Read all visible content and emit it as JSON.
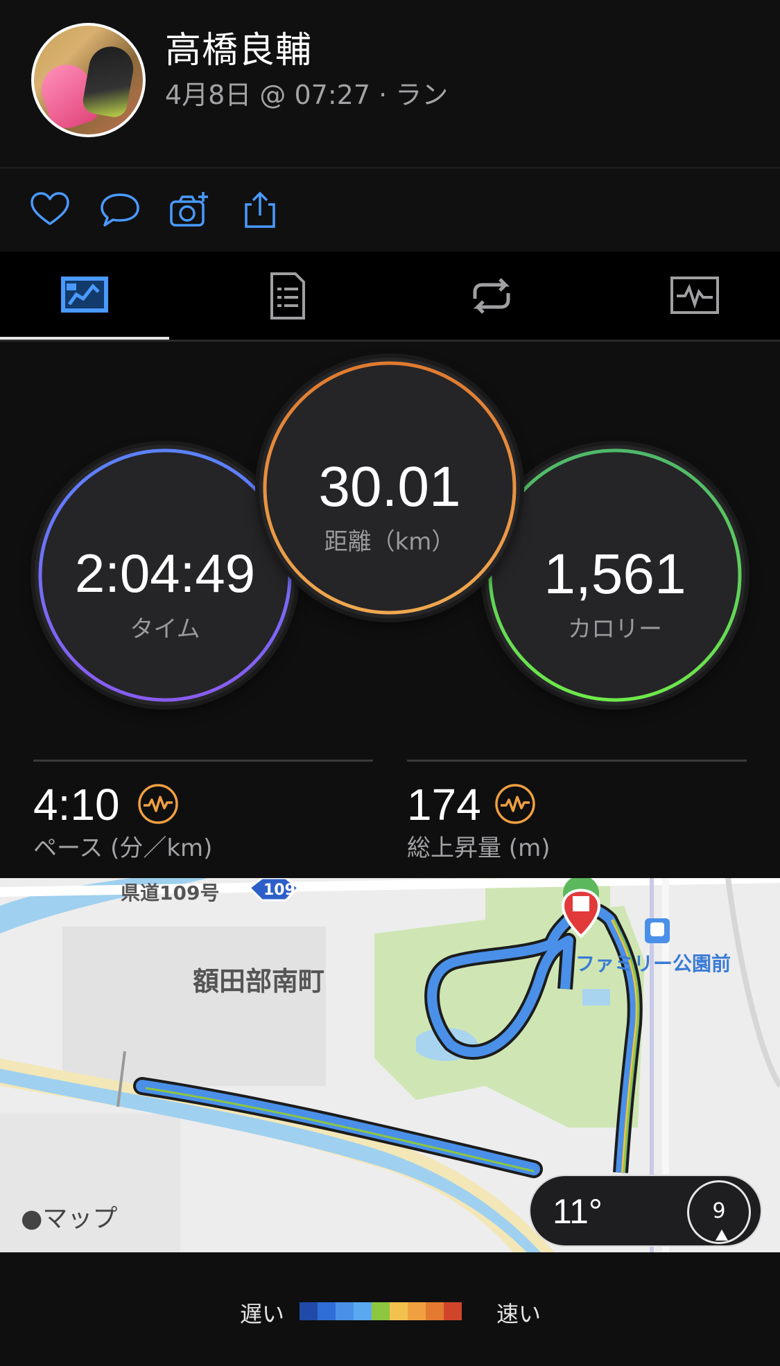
{
  "header": {
    "user_name": "高橋良輔",
    "meta": "4月8日 @ 07:27 · ラン"
  },
  "actions": [
    {
      "name": "like-heart-icon"
    },
    {
      "name": "comment-bubble-icon"
    },
    {
      "name": "add-photo-camera-icon"
    },
    {
      "name": "share-icon"
    }
  ],
  "tabs": [
    {
      "name": "tab-overview",
      "icon": "overview-icon",
      "active": true
    },
    {
      "name": "tab-stats",
      "icon": "document-list-icon",
      "active": false
    },
    {
      "name": "tab-laps",
      "icon": "repeat-icon",
      "active": false
    },
    {
      "name": "tab-charts",
      "icon": "activity-chart-icon",
      "active": false
    }
  ],
  "rings": {
    "time": {
      "value": "2:04:49",
      "label": "タイム"
    },
    "distance": {
      "value": "30.01",
      "label": "距離（km）"
    },
    "calories": {
      "value": "1,561",
      "label": "カロリー"
    }
  },
  "stats": {
    "pace": {
      "value": "4:10",
      "label": "ペース (分／km)"
    },
    "ascent": {
      "value": "174",
      "label": "総上昇量 (m)"
    }
  },
  "map": {
    "road_label": "県道109号",
    "road_badge": "109",
    "area_label": "額田部南町",
    "station_label": "ファミリー公園前",
    "attribution": "マップ",
    "temperature": "11°",
    "wind_speed": "9"
  },
  "legend": {
    "slow": "遅い",
    "fast": "速い",
    "colors": [
      "#1f4aa8",
      "#2d6fd6",
      "#4a90e8",
      "#5aa8f0",
      "#8dc63f",
      "#f2c14e",
      "#f0a040",
      "#e47a30",
      "#d0452a"
    ]
  }
}
